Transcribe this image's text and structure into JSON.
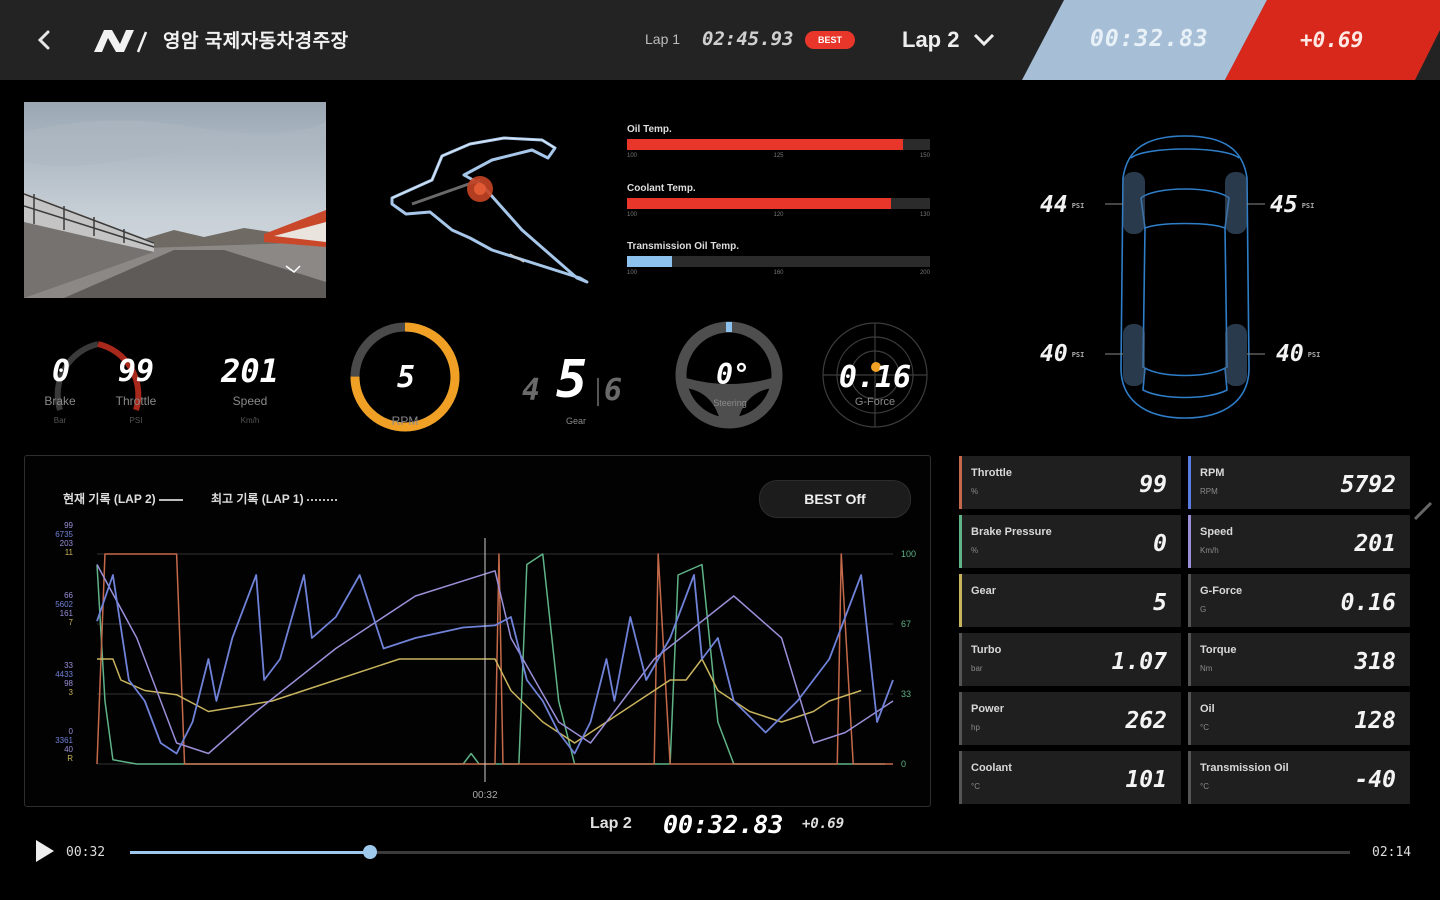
{
  "header": {
    "track_name": "영암 국제자동차경주장",
    "lap1_label": "Lap 1",
    "lap1_time": "02:45.93",
    "best_badge": "BEST",
    "lap_select": "Lap 2",
    "current_time": "00:32.83",
    "delta": "+0.69"
  },
  "temps": [
    {
      "label": "Oil Temp.",
      "fraction": 0.91,
      "color": "#e8372a",
      "ticks": [
        "100",
        "125",
        "150"
      ]
    },
    {
      "label": "Coolant Temp.",
      "fraction": 0.87,
      "color": "#e8372a",
      "ticks": [
        "100",
        "120",
        "130"
      ]
    },
    {
      "label": "Transmission Oil Temp.",
      "fraction": 0.15,
      "color": "#8ec2ee",
      "ticks": [
        "100",
        "160",
        "200"
      ]
    }
  ],
  "tires": {
    "front_left": {
      "value": "44",
      "unit": "PSI"
    },
    "front_right": {
      "value": "45",
      "unit": "PSI"
    },
    "rear_left": {
      "value": "40",
      "unit": "PSI"
    },
    "rear_right": {
      "value": "40",
      "unit": "PSI"
    }
  },
  "gauges": {
    "brake": {
      "value": "0",
      "label": "Brake",
      "unit": "Bar",
      "fraction": 0
    },
    "throttle": {
      "value": "99",
      "label": "Throttle",
      "unit": "PSI",
      "fraction": 0.99
    },
    "speed": {
      "value": "201",
      "label": "Speed",
      "unit": "Km/h"
    },
    "rpm": {
      "value": "5",
      "label": "RPM",
      "fraction": 0.75
    },
    "gear": {
      "prev": "4",
      "current": "5",
      "next": "6",
      "label": "Gear"
    },
    "steering": {
      "value": "0°",
      "label": "Steering"
    },
    "gforce": {
      "value": "0.16",
      "label": "G-Force"
    }
  },
  "chart": {
    "legend_current": "현재 기록 (LAP 2)",
    "legend_best": "최고 기록 (LAP 1)",
    "best_toggle": "BEST Off",
    "left_axis": [
      [
        "99",
        "6735",
        "203",
        "11"
      ],
      [
        "66",
        "5602",
        "161",
        "7"
      ],
      [
        "33",
        "4433",
        "98",
        "3"
      ],
      [
        "0",
        "3361",
        "40",
        "R"
      ]
    ],
    "right_axis": [
      "100",
      "67",
      "33",
      "0"
    ],
    "cursor_label": "00:32",
    "colors": {
      "rpm": "#6f82d8",
      "speed": "#9b8fd8",
      "throttle": "#5fb387",
      "brake": "#c46a4a",
      "gear": "#c9b45e"
    }
  },
  "stats": [
    {
      "name": "Throttle",
      "unit": "%",
      "value": "99",
      "color": "#c46a4a"
    },
    {
      "name": "RPM",
      "unit": "RPM",
      "value": "5792",
      "color": "#5a7de0"
    },
    {
      "name": "Brake Pressure",
      "unit": "%",
      "value": "0",
      "color": "#5fb387"
    },
    {
      "name": "Speed",
      "unit": "Km/h",
      "value": "201",
      "color": "#9b8fd8"
    },
    {
      "name": "Gear",
      "unit": "",
      "value": "5",
      "color": "#c9b45e"
    },
    {
      "name": "G-Force",
      "unit": "G",
      "value": "0.16",
      "color": "#555555"
    },
    {
      "name": "Turbo",
      "unit": "bar",
      "value": "1.07",
      "color": "#555555"
    },
    {
      "name": "Torque",
      "unit": "Nm",
      "value": "318",
      "color": "#555555"
    },
    {
      "name": "Power",
      "unit": "hp",
      "value": "262",
      "color": "#555555"
    },
    {
      "name": "Oil",
      "unit": "°C",
      "value": "128",
      "color": "#555555"
    },
    {
      "name": "Coolant",
      "unit": "°C",
      "value": "101",
      "color": "#555555"
    },
    {
      "name": "Transmission Oil",
      "unit": "°C",
      "value": "-40",
      "color": "#555555"
    }
  ],
  "playback": {
    "current": "00:32",
    "end": "02:14",
    "progress_fraction": 0.197,
    "lap_label": "Lap 2",
    "lap_time": "00:32.83",
    "delta": "+0.69"
  }
}
